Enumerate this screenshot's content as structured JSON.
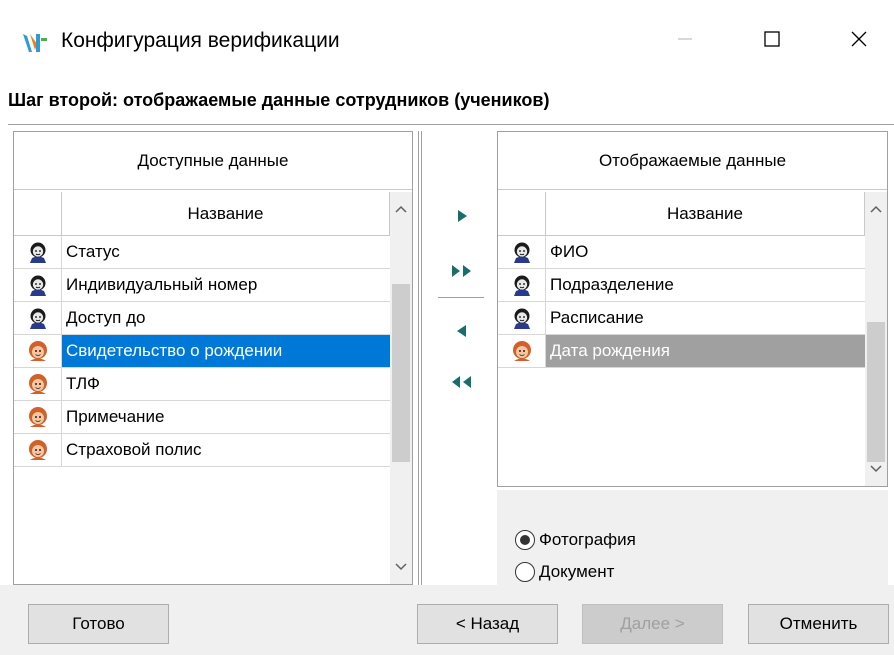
{
  "window": {
    "title": "Конфигурация верификации",
    "step_title": "Шаг второй: отображаемые данные сотрудников (учеников)"
  },
  "available": {
    "header": "Доступные данные",
    "column": "Название",
    "items": [
      {
        "label": "Статус",
        "icon": "employee-icon"
      },
      {
        "label": "Индивидуальный номер",
        "icon": "employee-icon"
      },
      {
        "label": "Доступ до",
        "icon": "employee-icon"
      },
      {
        "label": "Свидетельство о рождении",
        "icon": "student-icon",
        "selected": true
      },
      {
        "label": "ТЛФ",
        "icon": "student-icon"
      },
      {
        "label": "Примечание",
        "icon": "student-icon"
      },
      {
        "label": "Страховой полис",
        "icon": "student-icon"
      }
    ]
  },
  "displayed": {
    "header": "Отображаемые данные",
    "column": "Название",
    "items": [
      {
        "label": "ФИО",
        "icon": "employee-icon"
      },
      {
        "label": "Подразделение",
        "icon": "employee-icon"
      },
      {
        "label": "Расписание",
        "icon": "employee-icon"
      },
      {
        "label": "Дата рождения",
        "icon": "student-icon",
        "selected": true
      }
    ]
  },
  "transfer_icons": [
    "add-one-icon",
    "add-all-icon",
    "remove-one-icon",
    "remove-all-icon"
  ],
  "view_mode": {
    "options": [
      "Фотография",
      "Документ"
    ],
    "selected": "Фотография"
  },
  "buttons": {
    "done": "Готово",
    "back": "< Назад",
    "next": "Далее >",
    "cancel": "Отменить"
  },
  "colors": {
    "selection": "#0078d7",
    "inactive_selection": "#a0a0a0",
    "arrow": "#1a6e6a"
  }
}
